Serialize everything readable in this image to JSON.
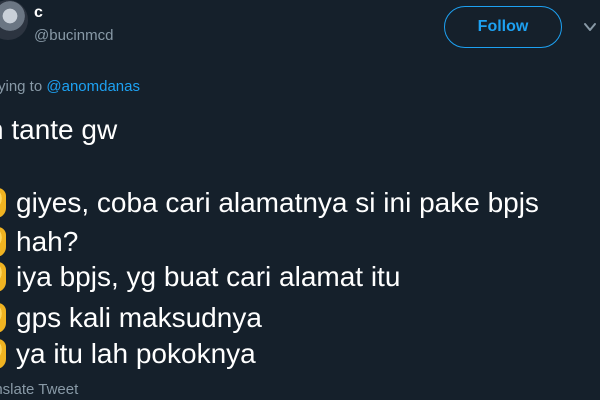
{
  "author": {
    "display_name": "c",
    "handle": "@bucinmcd"
  },
  "follow_label": "Follow",
  "reply": {
    "prefix": "ying to ",
    "mention": "@anomdanas"
  },
  "tweet": {
    "intro": "n tante gw",
    "lines": [
      "giyes, coba cari alamatnya si ini pake bpjs",
      "hah?",
      "iya bpjs, yg buat cari alamat itu",
      "gps kali maksudnya",
      "ya itu lah pokoknya"
    ]
  },
  "translate_label": "anslate Tweet",
  "colors": {
    "background": "#15202b",
    "accent": "#1da1f2",
    "muted": "#8899a6"
  }
}
